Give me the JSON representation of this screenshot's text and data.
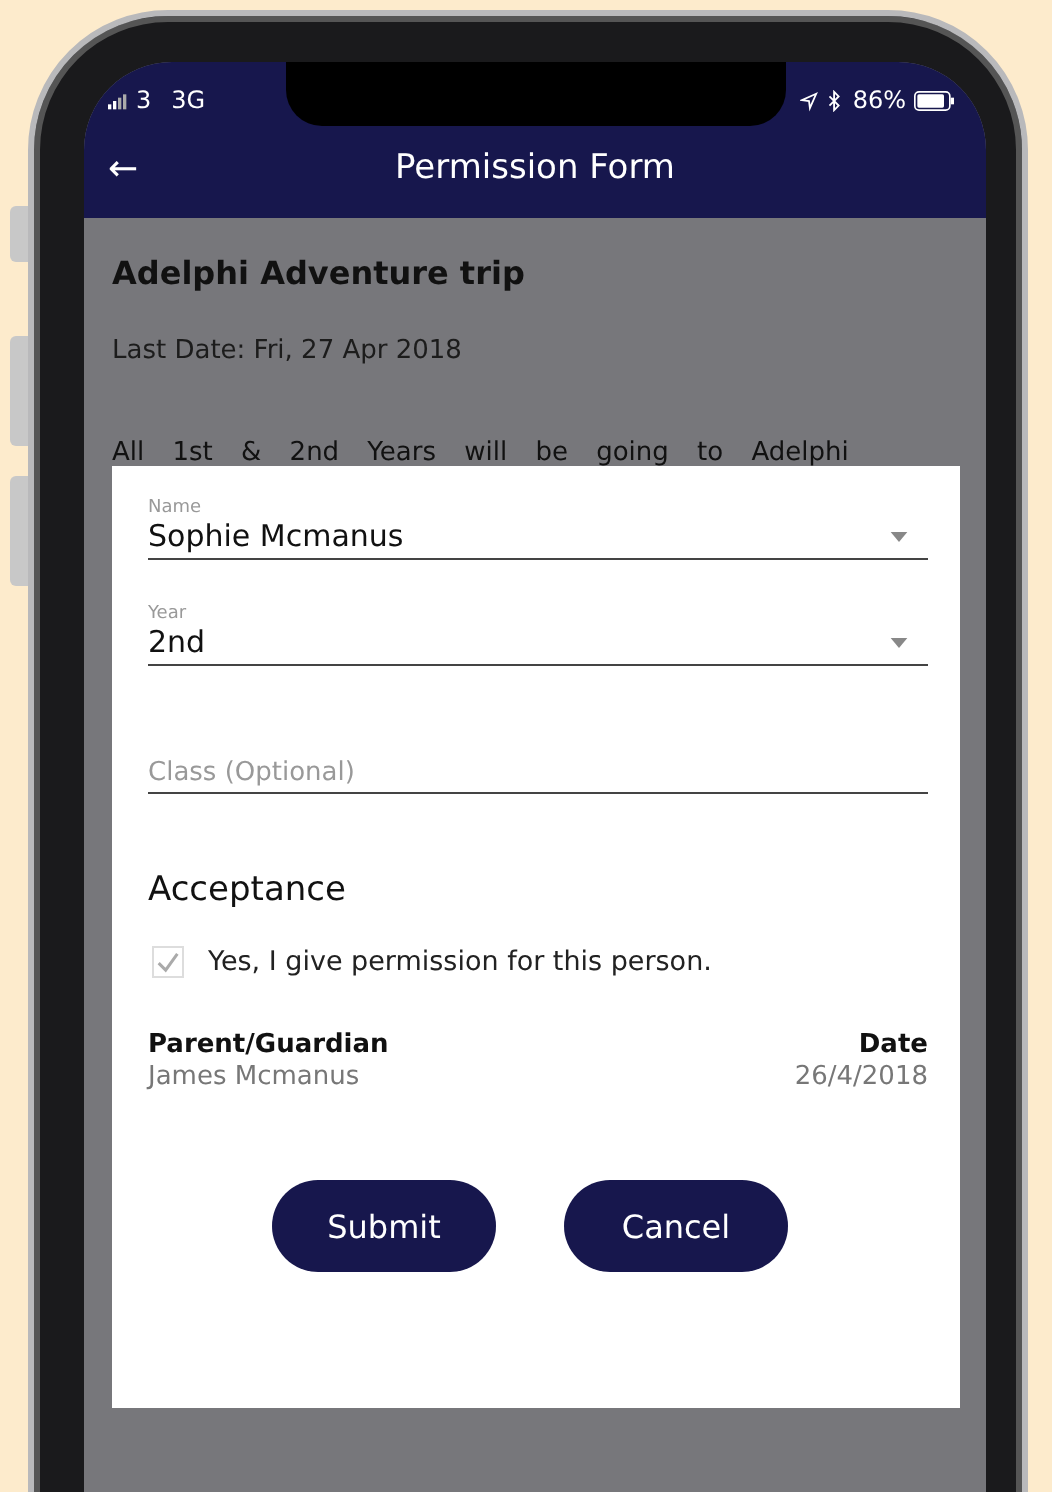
{
  "status_bar": {
    "carrier": "3",
    "network": "3G",
    "battery": "86%"
  },
  "header": {
    "back": "←",
    "title": "Permission Form"
  },
  "trip": {
    "title": "Adelphi Adventure trip",
    "last_date": "Last Date: Fri, 27 Apr 2018",
    "description": "All 1st & 2nd Years will be going to Adelphi"
  },
  "dialog": {
    "fields": [
      {
        "kind": "select",
        "label": "Name",
        "value": "Sophie Mcmanus"
      },
      {
        "kind": "select",
        "label": "Year",
        "value": "2nd"
      },
      {
        "kind": "text",
        "placeholder": "Class (Optional)"
      }
    ],
    "section_title": "Acceptance",
    "consent": {
      "label": "Yes, I give permission for this person.",
      "checked": true
    },
    "guardian": {
      "label": "Parent/Guardian",
      "value": "James Mcmanus"
    },
    "date": {
      "label": "Date",
      "value": "26/4/2018"
    },
    "buttons": [
      "Submit",
      "Cancel"
    ]
  }
}
